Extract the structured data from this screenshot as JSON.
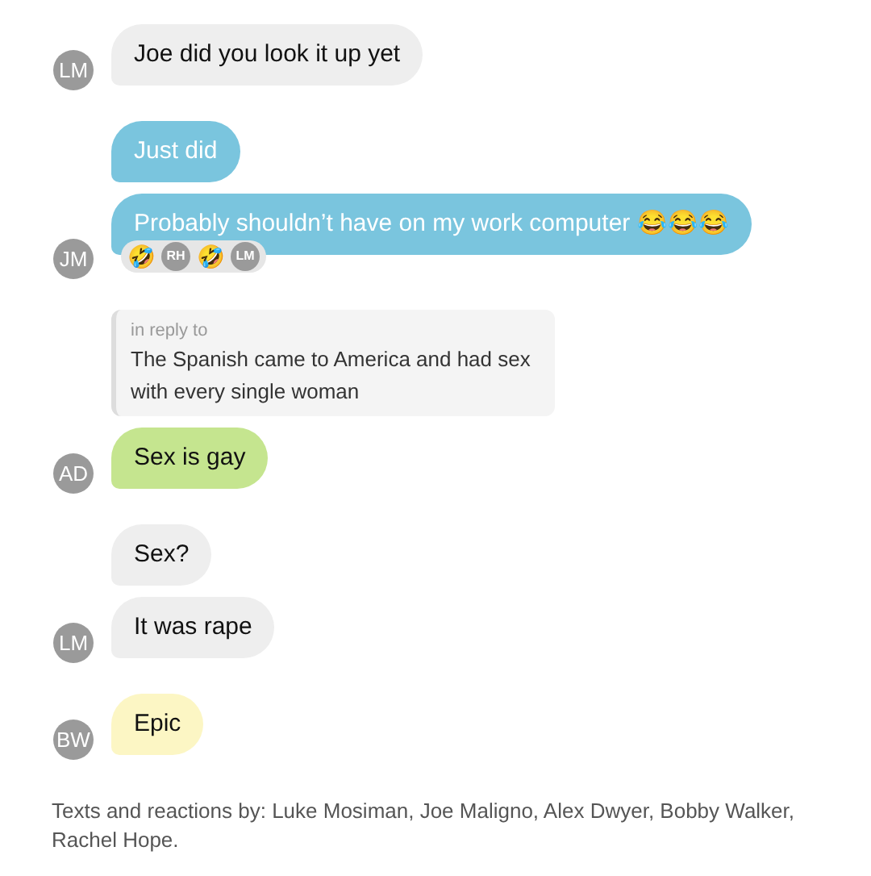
{
  "groups": [
    {
      "sender": "LM",
      "color": "#eeeeee",
      "messages": [
        {
          "text": "Joe did you look it up yet"
        }
      ]
    },
    {
      "sender": "JM",
      "color": "#7ac5de",
      "messages": [
        {
          "text": "Just did"
        },
        {
          "text": "Probably shouldn’t have on my work computer 😂😂😂",
          "reactions": [
            {
              "kind": "emoji",
              "text": "🤣"
            },
            {
              "kind": "avatar",
              "text": "RH"
            },
            {
              "kind": "emoji",
              "text": "🤣"
            },
            {
              "kind": "avatar",
              "text": "LM"
            }
          ]
        }
      ]
    },
    {
      "sender": "AD",
      "color": "#c5e58f",
      "reply": {
        "label": "in reply to",
        "text": "The Spanish came to America and had sex with every single woman"
      },
      "messages": [
        {
          "text": "Sex is gay"
        }
      ]
    },
    {
      "sender": "LM",
      "color": "#eeeeee",
      "messages": [
        {
          "text": "Sex?"
        },
        {
          "text": "It was rape"
        }
      ]
    },
    {
      "sender": "BW",
      "color": "#fcf6c4",
      "messages": [
        {
          "text": "Epic"
        }
      ]
    }
  ],
  "footer": "Texts and reactions by: Luke Mosiman, Joe Maligno, Alex Dwyer, Bobby Walker, Rachel Hope."
}
